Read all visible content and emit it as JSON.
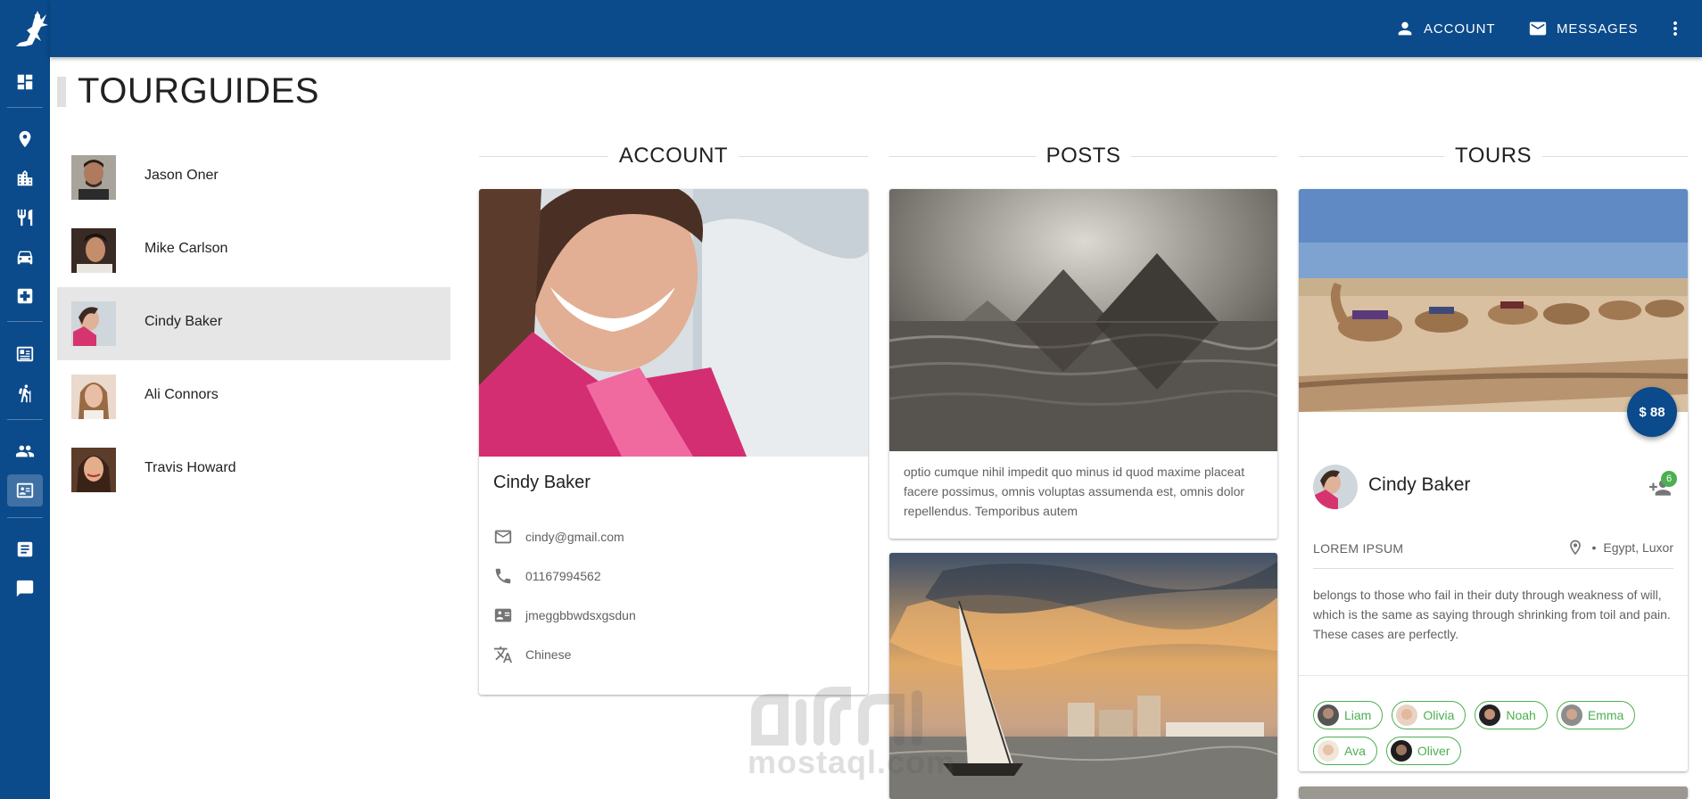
{
  "topbar": {
    "account_label": "ACCOUNT",
    "messages_label": "MESSAGES"
  },
  "page": {
    "title": "TOURGUIDES"
  },
  "sidebar": {
    "items": [
      {
        "icon": "dashboard-icon"
      },
      {
        "icon": "map-pin-icon"
      },
      {
        "icon": "city-icon"
      },
      {
        "icon": "restaurant-icon"
      },
      {
        "icon": "car-icon"
      },
      {
        "icon": "hospital-icon"
      },
      {
        "icon": "id-list-icon"
      },
      {
        "icon": "hiking-icon"
      },
      {
        "icon": "people-icon"
      },
      {
        "icon": "contact-card-icon",
        "active": true
      },
      {
        "icon": "article-icon"
      },
      {
        "icon": "chat-icon"
      }
    ]
  },
  "people": [
    {
      "name": "Jason Oner"
    },
    {
      "name": "Mike Carlson"
    },
    {
      "name": "Cindy Baker",
      "selected": true
    },
    {
      "name": "Ali Connors"
    },
    {
      "name": "Travis Howard"
    }
  ],
  "sections": {
    "account": "ACCOUNT",
    "posts": "POSTS",
    "tours": "TOURS"
  },
  "account": {
    "name": "Cindy Baker",
    "email": "cindy@gmail.com",
    "phone": "01167994562",
    "id": "jmeggbbwdsxgsdun",
    "language": "Chinese"
  },
  "posts": [
    {
      "text": "optio cumque nihil impedit quo minus id quod maxime placeat facere possimus, omnis voluptas assumenda est, omnis dolor repellendus. Temporibus autem"
    }
  ],
  "tour": {
    "price": "$ 88",
    "guide": "Cindy Baker",
    "badge": "6",
    "tag": "LOREM IPSUM",
    "bullet": "•",
    "location": "Egypt, Luxor",
    "description": "belongs to those who fail in their duty through weakness of will, which is the same as saying through shrinking from toil and pain. These cases are perfectly.",
    "chips": [
      {
        "name": "Liam"
      },
      {
        "name": "Olivia"
      },
      {
        "name": "Noah"
      },
      {
        "name": "Emma"
      },
      {
        "name": "Ava"
      },
      {
        "name": "Oliver"
      }
    ]
  },
  "watermark": {
    "text": "mostaql.com"
  },
  "colors": {
    "primary": "#0b4a8b",
    "accent_green": "#4caf50",
    "selected_row": "#e6e6e6"
  }
}
